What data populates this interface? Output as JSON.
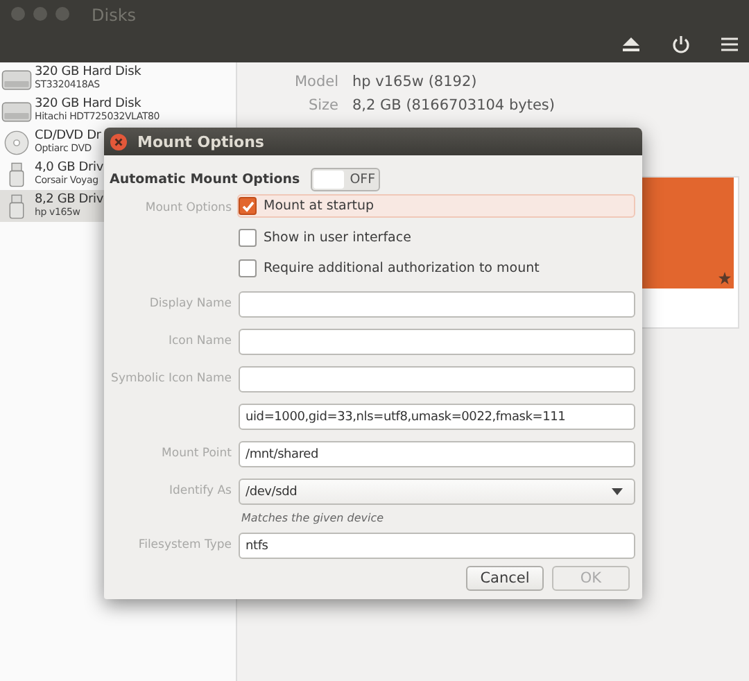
{
  "window": {
    "title": "Disks"
  },
  "drives": [
    {
      "kind": "hdd",
      "name": "320 GB Hard Disk",
      "detail": "ST3320418AS",
      "selected": false
    },
    {
      "kind": "hdd",
      "name": "320 GB Hard Disk",
      "detail": "Hitachi HDT725032VLAT80",
      "selected": false
    },
    {
      "kind": "optical",
      "name": "CD/DVD Dr",
      "detail": "Optiarc DVD",
      "selected": false
    },
    {
      "kind": "usb",
      "name": "4,0 GB Driv",
      "detail": "Corsair Voyag",
      "selected": false
    },
    {
      "kind": "usb",
      "name": "8,2 GB Driv",
      "detail": "hp v165w",
      "selected": true
    }
  ],
  "details": [
    {
      "label": "Model",
      "value": "hp v165w (8192)"
    },
    {
      "label": "Size",
      "value": "8,2 GB (8166703104 bytes)"
    }
  ],
  "dialog": {
    "title": "Mount Options",
    "auto_mount": {
      "label": "Automatic Mount Options",
      "on": false,
      "state_text": "OFF"
    },
    "options_label": "Mount Options",
    "options": [
      {
        "label": "Mount at startup",
        "checked": true,
        "focused": true
      },
      {
        "label": "Show in user interface",
        "checked": false,
        "focused": false
      },
      {
        "label": "Require additional authorization to mount",
        "checked": false,
        "focused": false
      }
    ],
    "fields": [
      {
        "kind": "text",
        "label": "Display Name"
      },
      {
        "kind": "text",
        "label": "Icon Name"
      },
      {
        "kind": "text",
        "label": "Symbolic Icon Name"
      },
      {
        "kind": "text",
        "value": "uid=1000,gid=33,nls=utf8,umask=0022,fmask=111"
      },
      {
        "kind": "text",
        "label": "Mount Point",
        "value": "/mnt/shared"
      },
      {
        "kind": "dropdown",
        "label": "Identify As",
        "value": "/dev/sdd",
        "hint": "Matches the given device"
      },
      {
        "kind": "text",
        "label": "Filesystem Type",
        "value": "ntfs"
      }
    ],
    "buttons": [
      {
        "label": "Cancel",
        "disabled": false
      },
      {
        "label": "OK",
        "disabled": true
      }
    ]
  }
}
